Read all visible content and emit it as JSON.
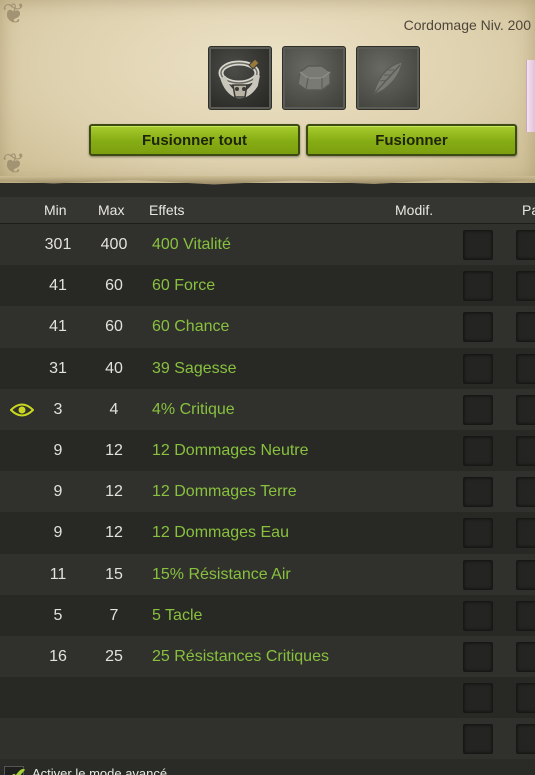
{
  "header": {
    "level_text": "Cordomage Niv. 200",
    "slots": [
      {
        "icon": "belt-item-icon",
        "state": "filled"
      },
      {
        "icon": "rune-slot-icon",
        "state": "empty"
      },
      {
        "icon": "feather-slot-icon",
        "state": "empty"
      }
    ],
    "buttons": {
      "fuse_all": "Fusionner tout",
      "fuse": "Fusionner"
    }
  },
  "table": {
    "columns": {
      "min": "Min",
      "max": "Max",
      "effects": "Effets",
      "modif": "Modif.",
      "pa": "Pa"
    },
    "rows": [
      {
        "min": "301",
        "max": "400",
        "effect": "400 Vitalité",
        "eye": false
      },
      {
        "min": "41",
        "max": "60",
        "effect": "60 Force",
        "eye": false
      },
      {
        "min": "41",
        "max": "60",
        "effect": "60 Chance",
        "eye": false
      },
      {
        "min": "31",
        "max": "40",
        "effect": "39 Sagesse",
        "eye": false
      },
      {
        "min": "3",
        "max": "4",
        "effect": "4% Critique",
        "eye": true
      },
      {
        "min": "9",
        "max": "12",
        "effect": "12 Dommages Neutre",
        "eye": false
      },
      {
        "min": "9",
        "max": "12",
        "effect": "12 Dommages Terre",
        "eye": false
      },
      {
        "min": "9",
        "max": "12",
        "effect": "12 Dommages Eau",
        "eye": false
      },
      {
        "min": "11",
        "max": "15",
        "effect": "15% Résistance Air",
        "eye": false
      },
      {
        "min": "5",
        "max": "7",
        "effect": "5 Tacle",
        "eye": false
      },
      {
        "min": "16",
        "max": "25",
        "effect": "25 Résistances Critiques",
        "eye": false
      },
      {
        "min": "",
        "max": "",
        "effect": "",
        "eye": false
      },
      {
        "min": "",
        "max": "",
        "effect": "",
        "eye": false
      }
    ]
  },
  "footer": {
    "checkbox_label": "Activer le mode avancé",
    "checked": true
  },
  "colors": {
    "effect_text": "#88c13e",
    "button_green": "#86ac14",
    "parchment": "#ddd0ad",
    "eye_icon": "#c8d820"
  }
}
